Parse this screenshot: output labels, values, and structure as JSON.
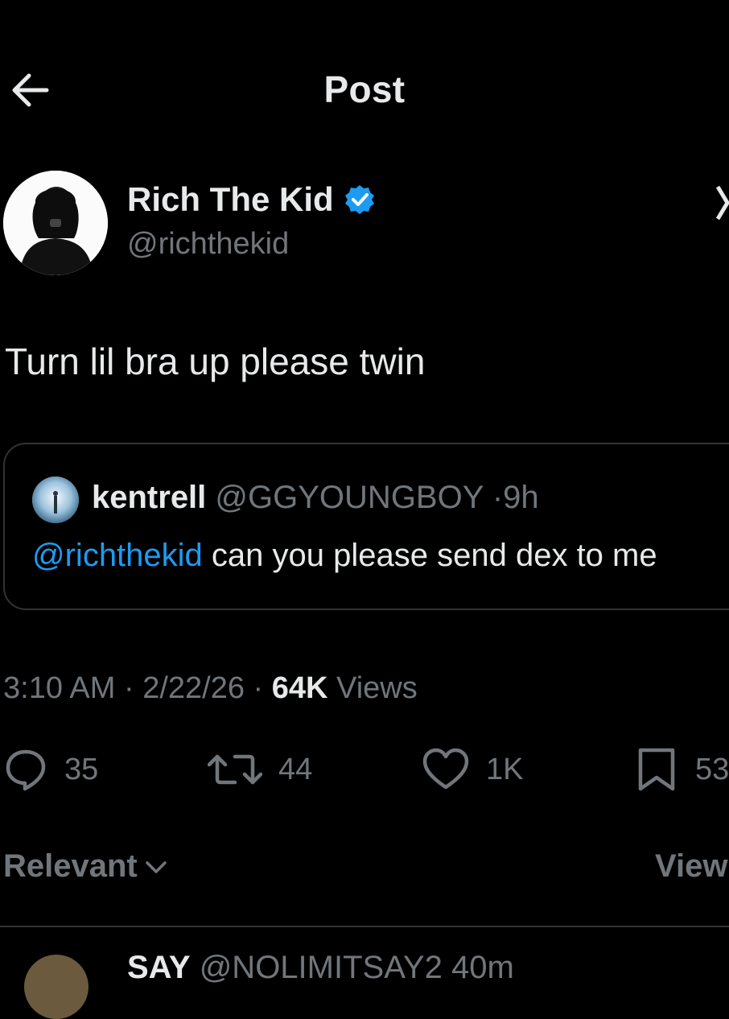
{
  "header": {
    "title": "Post",
    "back_icon": "arrow-left-icon"
  },
  "author": {
    "display_name": "Rich The Kid",
    "handle": "@richthekid",
    "verified": true,
    "verified_color": "#1d9bf0"
  },
  "post": {
    "text": "Turn lil bra up please twin"
  },
  "quote": {
    "name": "kentrell",
    "handle": "@GGYOUNGBOY",
    "separator": "·",
    "time": "9h",
    "mention": "@richthekid",
    "text": " can you please send dex to me"
  },
  "meta": {
    "time": "3:10 AM",
    "date": "2/22/26",
    "views_count": "64K",
    "views_label": " Views",
    "dot": " · "
  },
  "actions": {
    "replies": "35",
    "reposts": "44",
    "likes": "1K",
    "bookmarks": "53"
  },
  "sort": {
    "label": "Relevant",
    "view_label": "View"
  },
  "next_reply": {
    "name": "SAY",
    "handle": "@NOLIMITSAY2",
    "time": "40m"
  },
  "colors": {
    "background": "#000000",
    "text": "#e7e9ea",
    "muted": "#71767b",
    "accent": "#1d9bf0",
    "border": "#2f3336"
  }
}
